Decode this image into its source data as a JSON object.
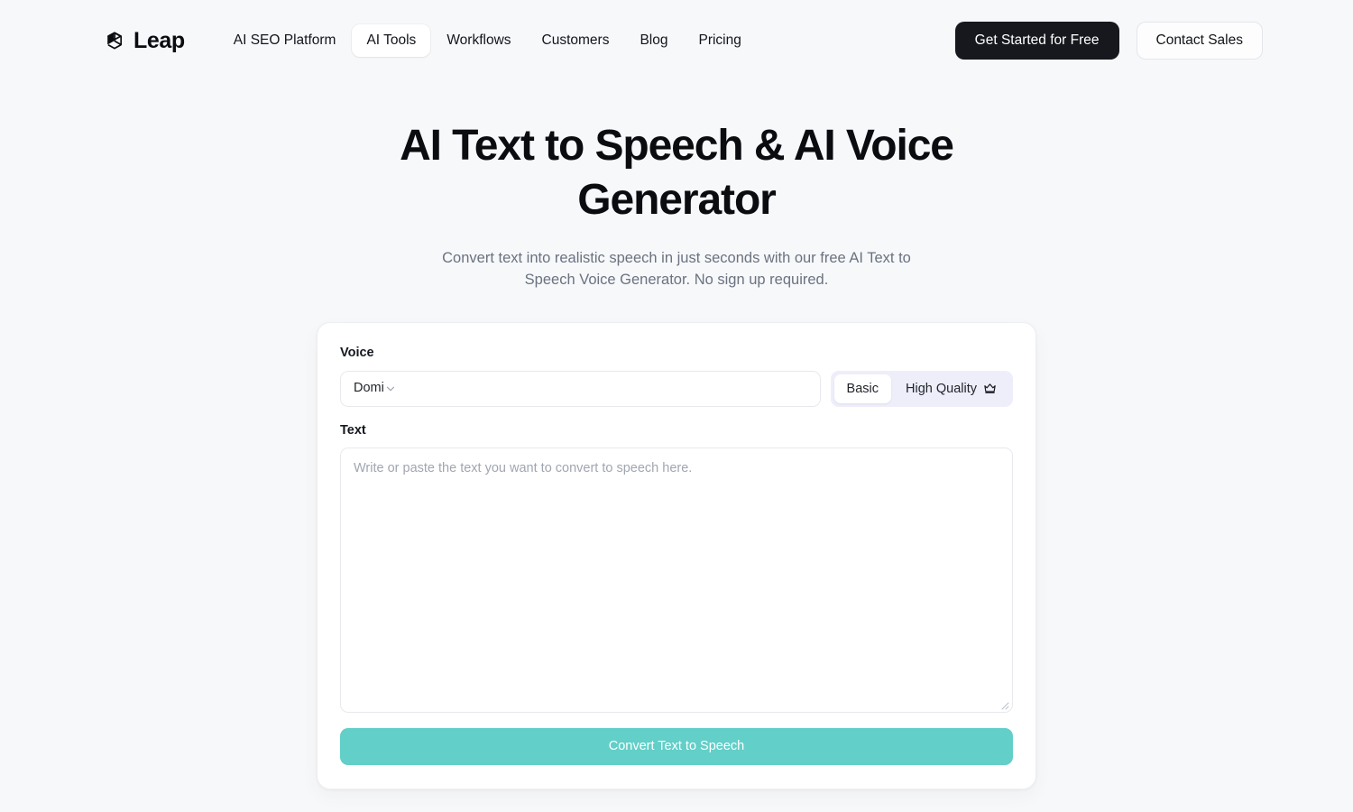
{
  "header": {
    "brand": {
      "name": "Leap",
      "icon": "cube-logo-icon"
    },
    "nav": [
      {
        "label": "AI SEO Platform",
        "active": false
      },
      {
        "label": "AI Tools",
        "active": true
      },
      {
        "label": "Workflows",
        "active": false
      },
      {
        "label": "Customers",
        "active": false
      },
      {
        "label": "Blog",
        "active": false
      },
      {
        "label": "Pricing",
        "active": false
      }
    ],
    "cta_primary": "Get Started for Free",
    "cta_secondary": "Contact Sales"
  },
  "hero": {
    "title": "AI Text to Speech & AI Voice Generator",
    "subtitle": "Convert text into realistic speech in just seconds with our free AI Text to Speech Voice Generator. No sign up required."
  },
  "tool": {
    "voice_label": "Voice",
    "voice_selected": "Domi",
    "quality": {
      "basic_label": "Basic",
      "high_quality_label": "High Quality",
      "high_quality_icon": "crown-icon",
      "selected": "Basic"
    },
    "text_label": "Text",
    "text_value": "",
    "text_placeholder": "Write or paste the text you want to convert to speech here.",
    "submit_label": "Convert Text to Speech"
  },
  "colors": {
    "page_bg": "#f7f8fa",
    "accent_button": "#62cfc8",
    "dark_button": "#16181d",
    "segmented_bg": "#eeeefb",
    "muted_text": "#6b7280"
  }
}
